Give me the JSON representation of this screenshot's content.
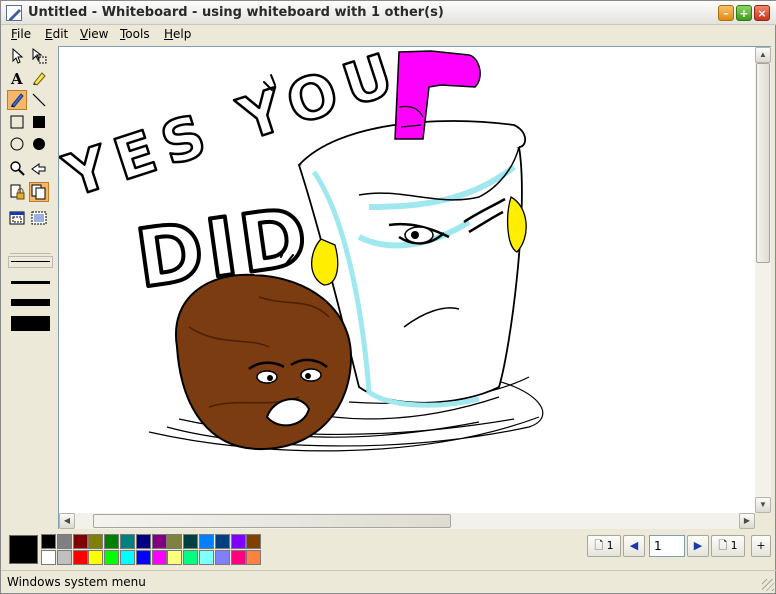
{
  "window": {
    "title": "Untitled - Whiteboard - using whiteboard with 1 other(s)",
    "icon": "whiteboard-app-icon"
  },
  "title_buttons": {
    "minimize": "–",
    "maximize": "+",
    "close": "×"
  },
  "menu": [
    "File",
    "Edit",
    "View",
    "Tools",
    "Help"
  ],
  "tools": [
    {
      "name": "select-arrow-icon",
      "active": false
    },
    {
      "name": "select-area-icon",
      "active": false
    },
    {
      "name": "text-tool-icon",
      "label": "A",
      "active": false
    },
    {
      "name": "highlighter-icon",
      "active": false
    },
    {
      "name": "pen-icon",
      "active": true
    },
    {
      "name": "line-icon",
      "active": false
    },
    {
      "name": "rectangle-outline-icon",
      "active": false
    },
    {
      "name": "rectangle-filled-icon",
      "active": false
    },
    {
      "name": "ellipse-outline-icon",
      "active": false
    },
    {
      "name": "ellipse-filled-icon",
      "active": false
    },
    {
      "name": "zoom-icon",
      "active": false
    },
    {
      "name": "remote-pointer-icon",
      "active": false
    },
    {
      "name": "lock-contents-icon",
      "active": false
    },
    {
      "name": "synchronize-icon",
      "active": true
    },
    {
      "name": "select-window-icon",
      "active": false
    },
    {
      "name": "select-area-capture-icon",
      "active": false
    }
  ],
  "line_widths": [
    "thin",
    "medium",
    "thick",
    "thickest"
  ],
  "drawing": {
    "text_line1": "YES YOU",
    "text_line2": "DID",
    "colors": {
      "meatwad": "#7a3c10",
      "cup_cyan": "#9fe8ef",
      "straw": "#ff00ff",
      "arms": "#ffee00"
    }
  },
  "palette": {
    "foreground": "#000000",
    "row1": [
      "#000000",
      "#808080",
      "#800000",
      "#808000",
      "#008000",
      "#008080",
      "#000080",
      "#800080",
      "#808040",
      "#004040",
      "#0080ff",
      "#004080",
      "#8000ff",
      "#804000"
    ],
    "row2": [
      "#ffffff",
      "#c0c0c0",
      "#ff0000",
      "#ffff00",
      "#00ff00",
      "#00ffff",
      "#0000ff",
      "#ff00ff",
      "#ffff80",
      "#00ff80",
      "#80ffff",
      "#8080ff",
      "#ff0080",
      "#ff8040"
    ]
  },
  "pager": {
    "first_label": "1",
    "prev_icon": "prev-page-icon",
    "current_page": "1",
    "next_icon": "next-page-icon",
    "last_label": "1",
    "insert_icon": "insert-page-icon"
  },
  "status": "Windows system menu"
}
